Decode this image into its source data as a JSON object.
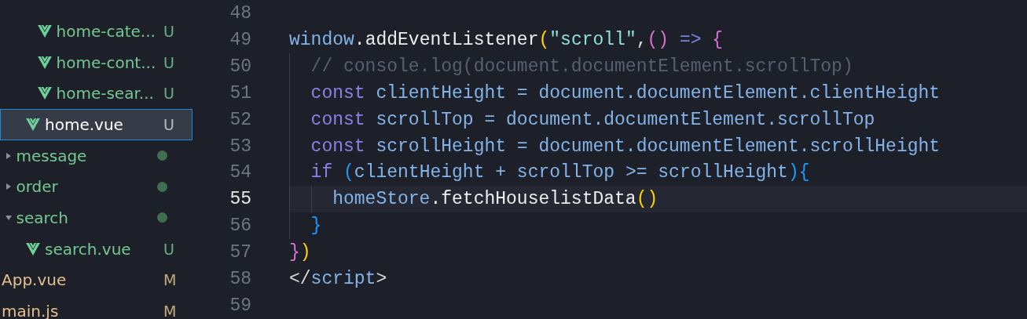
{
  "explorer": {
    "tree": [
      {
        "children": [
          {
            "children": [
              {
                "children": [
                  {
                    "name": "home-cate...",
                    "kind": "vue",
                    "color": "#73c991",
                    "badge": "U",
                    "selected": false
                  },
                  {
                    "name": "home-cont...",
                    "kind": "vue",
                    "color": "#73c991",
                    "badge": "U",
                    "selected": false
                  },
                  {
                    "name": "home-sear...",
                    "kind": "vue",
                    "color": "#73c991",
                    "badge": "U",
                    "selected": false
                  }
                ]
              },
              {
                "name": "home.vue",
                "kind": "vue",
                "badge": "U",
                "selected": true
              }
            ]
          },
          {
            "name": "message",
            "kind": "folder",
            "expanded": false,
            "color": "#73c991",
            "dot": true,
            "selected": false
          },
          {
            "name": "order",
            "kind": "folder",
            "expanded": false,
            "color": "#73c991",
            "dot": true,
            "selected": false
          },
          {
            "name": "search",
            "kind": "folder",
            "expanded": true,
            "color": "#73c991",
            "dot": true,
            "selected": false,
            "children": [
              {
                "name": "search.vue",
                "kind": "vue",
                "color": "#73c991",
                "badge": "U",
                "selected": false
              }
            ]
          }
        ]
      },
      {
        "name": "App.vue",
        "color": "#e2c08d",
        "badge": "M",
        "selected": false
      },
      {
        "name": "main.js",
        "color": "#e2c08d",
        "badge": "M",
        "selected": false
      }
    ]
  },
  "editor": {
    "lines": [
      {
        "number": "48",
        "current": false
      },
      {
        "number": "49",
        "current": false,
        "tokens": [
          {
            "text": "window",
            "kind": "var"
          },
          {
            "text": ".addEventListener",
            "kind": "fn"
          },
          {
            "text": "(",
            "kind": "p1"
          },
          {
            "text": "\"scroll\"",
            "kind": "str"
          },
          {
            "text": ",",
            "kind": "punc"
          },
          {
            "text": "()",
            "kind": "p2"
          },
          {
            "text": " => ",
            "kind": "op"
          },
          {
            "text": "{",
            "kind": "p2"
          }
        ]
      },
      {
        "number": "50",
        "current": false,
        "tokens": [
          {
            "text": "  // console.log(document.documentElement.scrollTop)",
            "kind": "comment"
          }
        ]
      },
      {
        "number": "51",
        "current": false,
        "tokens": [
          {
            "text": "  const",
            "kind": "kw"
          },
          {
            "text": " clientHeight = document.documentElement.clientHeight",
            "kind": "var"
          }
        ]
      },
      {
        "number": "52",
        "current": false,
        "tokens": [
          {
            "text": "  const",
            "kind": "kw"
          },
          {
            "text": " scrollTop = document.documentElement.scrollTop",
            "kind": "var"
          }
        ]
      },
      {
        "number": "53",
        "current": false,
        "tokens": [
          {
            "text": "  const",
            "kind": "kw"
          },
          {
            "text": " scrollHeight = document.documentElement.scrollHeight",
            "kind": "var"
          }
        ]
      },
      {
        "number": "54",
        "current": false,
        "tokens": [
          {
            "text": "  if ",
            "kind": "kw"
          },
          {
            "text": "(",
            "kind": "p3"
          },
          {
            "text": "clientHeight + scrollTop >= scrollHeight",
            "kind": "var"
          },
          {
            "text": "){",
            "kind": "p3"
          }
        ]
      },
      {
        "number": "55",
        "current": true,
        "tokens": [
          {
            "text": "    homeStore",
            "kind": "var"
          },
          {
            "text": ".fetchHouselistData",
            "kind": "fn"
          },
          {
            "text": "()",
            "kind": "p1"
          }
        ]
      },
      {
        "number": "56",
        "current": false,
        "tokens": [
          {
            "text": "  }",
            "kind": "p3"
          }
        ]
      },
      {
        "number": "57",
        "current": false,
        "tokens": [
          {
            "text": "}",
            "kind": "p2"
          },
          {
            "text": ")",
            "kind": "p1"
          }
        ]
      },
      {
        "number": "58",
        "current": false,
        "tokens": [
          {
            "text": "</",
            "kind": "punc"
          },
          {
            "text": "script",
            "kind": "var"
          },
          {
            "text": ">",
            "kind": "punc"
          }
        ]
      },
      {
        "number": "59",
        "current": false
      }
    ]
  }
}
